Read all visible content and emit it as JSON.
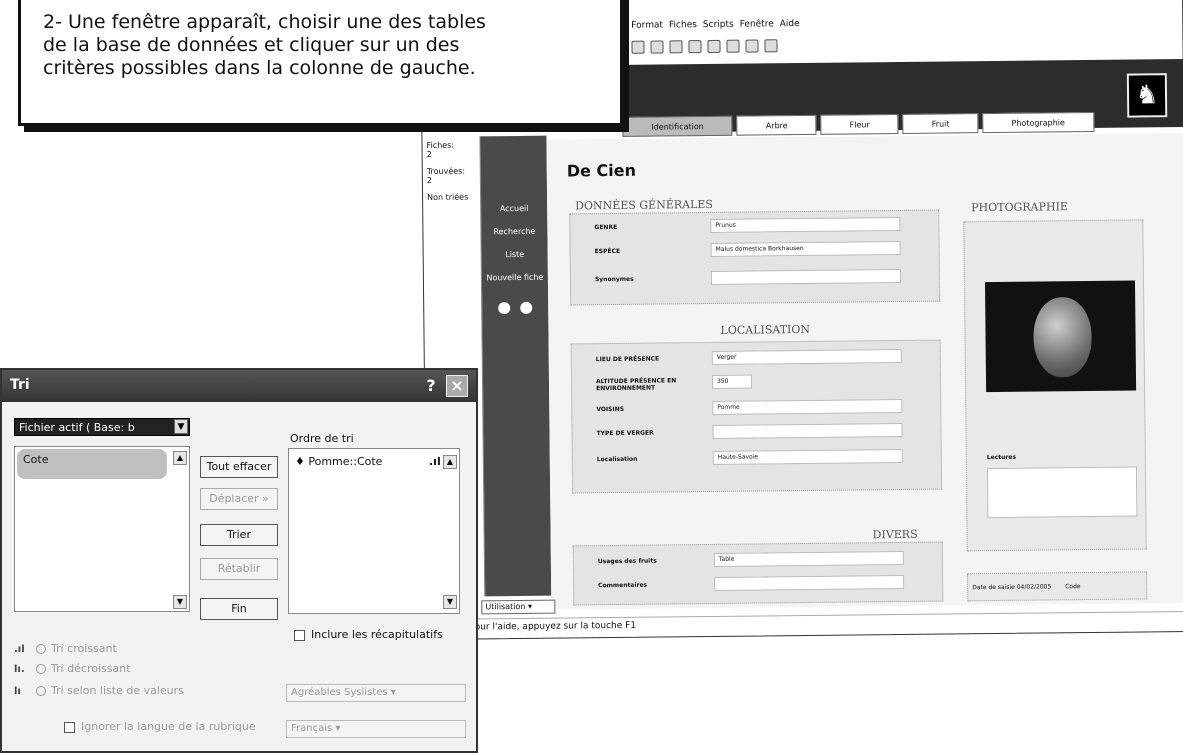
{
  "instruction": {
    "line1": "2- Une fenêtre apparaît, choisir une des tables",
    "line2": "de la base de données et cliquer sur un des",
    "line3": "critères possibles dans la colonne de gauche."
  },
  "fm": {
    "menu": [
      "Format",
      "Fiches",
      "Scripts",
      "Fenêtre",
      "Aide"
    ],
    "tabs": [
      "Identification",
      "Arbre",
      "Fleur",
      "Fruit",
      "Photographie"
    ],
    "status": {
      "records_label": "Fiches:",
      "records_value": "2",
      "found_label": "Trouvées:",
      "found_value": "2",
      "sort_label": "Non triées"
    },
    "nav": [
      "Accueil",
      "Recherche",
      "Liste",
      "Nouvelle fiche"
    ],
    "record_title": "De Cien",
    "sections": {
      "general": "DONNÉES GÉNÉRALES",
      "photo": "PHOTOGRAPHIE",
      "localisation": "LOCALISATION",
      "divers": "DIVERS"
    },
    "general_fields": [
      {
        "label": "GENRE",
        "value": "Prunus"
      },
      {
        "label": "ESPÈCE",
        "value": "Malus domestica Borkhausen"
      },
      {
        "label": "Synonymes",
        "value": ""
      }
    ],
    "loc_fields": [
      {
        "label": "LIEU DE PRÉSENCE",
        "value": "Verger"
      },
      {
        "label": "ALTITUDE PRÉSENCE EN ENVIRONNEMENT",
        "value": "350"
      },
      {
        "label": "VOISINS",
        "value": "Pomme"
      },
      {
        "label": "TYPE DE VERGER",
        "value": ""
      },
      {
        "label": "Localisation",
        "value": "Haute-Savoie"
      }
    ],
    "divers_fields": [
      {
        "label": "Usages des fruits",
        "value": "Table"
      },
      {
        "label": "Commentaires",
        "value": ""
      }
    ],
    "photo_caption": "Lectures",
    "date_label": "Date de saisie",
    "date_value": "04/02/2005",
    "code_label": "Code",
    "status_bar": "Pour l'aide, appuyez sur la touche F1",
    "util_select": "Utilisation"
  },
  "dialog": {
    "title": "Tri",
    "help": "?",
    "close": "×",
    "table_select": "Fichier actif ( Base: b",
    "field_item": "Cote",
    "sort_order_label": "Ordre de tri",
    "sort_order_item": "Pomme::Cote",
    "sort_order_icon": ".ıl",
    "buttons": {
      "clear_all": "Tout effacer",
      "move": "Déplacer »",
      "sort": "Trier",
      "restore": "Rétablir",
      "end": "Fin"
    },
    "include_summaries": "Inclure les récapitulatifs",
    "radio_ascending": "Tri croissant",
    "radio_descending": "Tri décroissant",
    "radio_custom": "Tri selon liste de valeurs",
    "custom_select": "Agréables Syslistes",
    "override_language": "Ignorer la langue de la rubrique",
    "language_select": "Français"
  }
}
